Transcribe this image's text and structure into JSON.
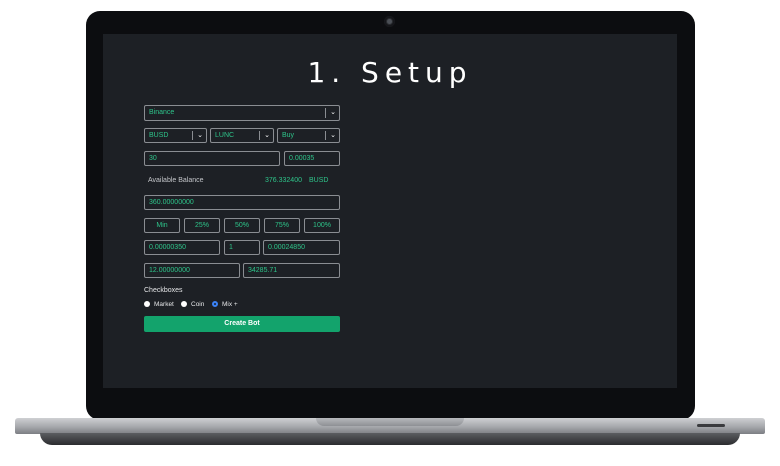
{
  "title": "1. Setup",
  "exchange": {
    "value": "Binance"
  },
  "pair": {
    "base": "BUSD",
    "quote": "LUNC",
    "side": "Buy"
  },
  "amount": {
    "value": "30",
    "price": "0.00035"
  },
  "balance": {
    "label": "Available Balance",
    "value": "376.332400",
    "currency": "BUSD"
  },
  "total": {
    "value": "360.00000000"
  },
  "percent_buttons": [
    "Min",
    "25%",
    "50%",
    "75%",
    "100%"
  ],
  "row_a": {
    "field1": "0.00000350",
    "field2": "1",
    "field3": "0.00024850"
  },
  "row_b": {
    "field1": "12.00000000",
    "field2": "34285.71"
  },
  "checkboxes": {
    "label": "Checkboxes",
    "options": [
      {
        "label": "Market",
        "checked": false
      },
      {
        "label": "Coin",
        "checked": false
      },
      {
        "label": "Mix +",
        "checked": true
      }
    ]
  },
  "create_button": "Create Bot",
  "colors": {
    "accent": "#13a36c",
    "text_accent": "#2ec48a",
    "background": "#1d2025"
  }
}
